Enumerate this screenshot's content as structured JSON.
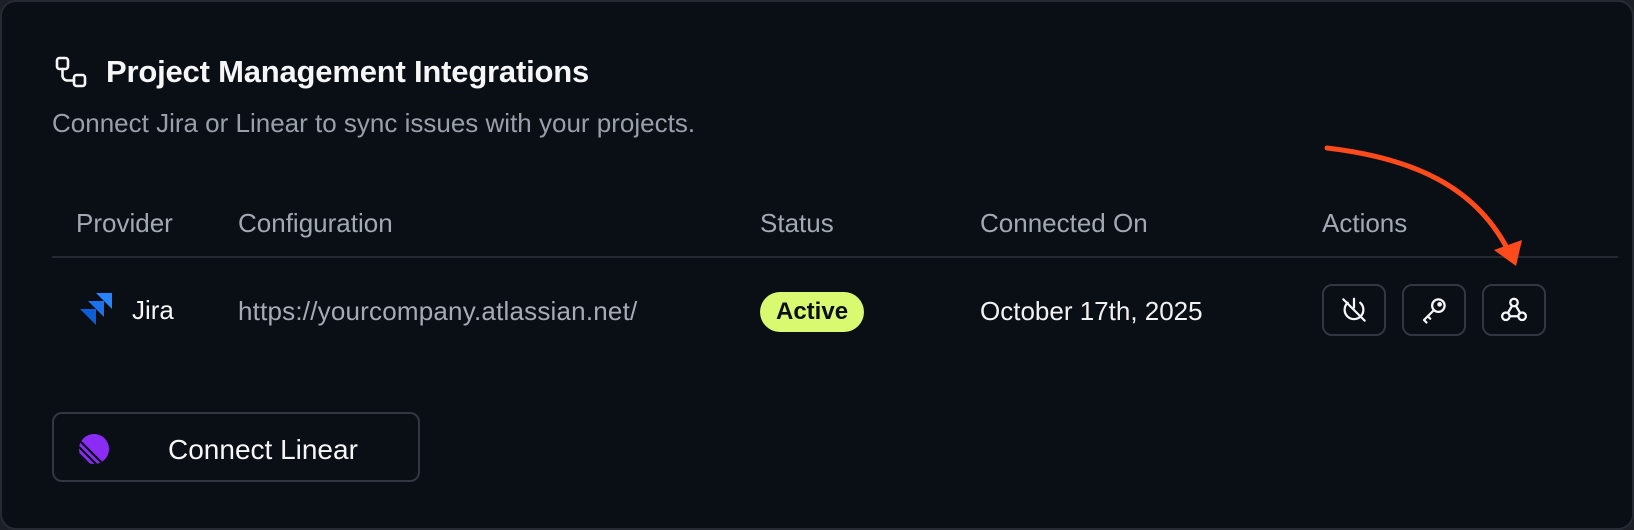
{
  "section": {
    "title": "Project Management Integrations",
    "subtitle": "Connect Jira or Linear to sync issues with your projects.",
    "icon": "integrations-icon"
  },
  "table": {
    "columns": [
      "Provider",
      "Configuration",
      "Status",
      "Connected On",
      "Actions"
    ],
    "rows": [
      {
        "provider": "Jira",
        "provider_icon": "jira-logo",
        "configuration": "https://yourcompany.atlassian.net/",
        "status": "Active",
        "connected_on": "October 17th, 2025",
        "actions": [
          "disconnect-icon",
          "key-icon",
          "webhook-icon"
        ]
      }
    ]
  },
  "connect_button": {
    "label": "Connect Linear",
    "icon": "linear-logo"
  },
  "colors": {
    "card_bg": "#0a0e15",
    "badge_bg": "#d9f970",
    "jira_blue": "#2684ff",
    "linear_purple": "#8b2cf5",
    "annotation_arrow": "#ff4a1c"
  }
}
